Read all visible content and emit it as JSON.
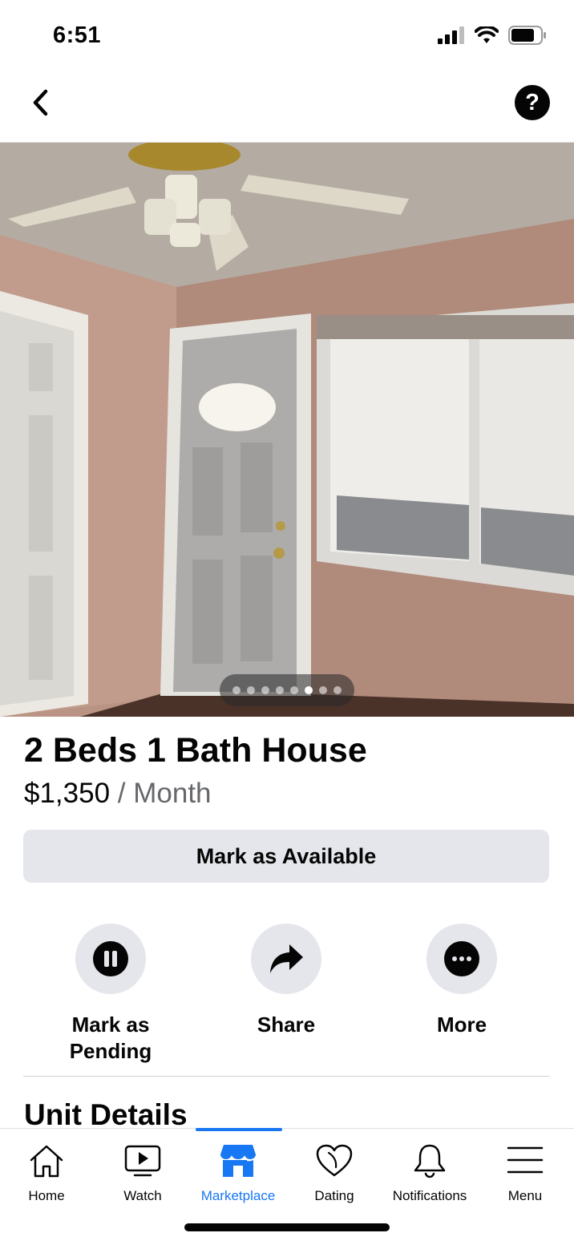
{
  "status_bar": {
    "time": "6:51",
    "icons": [
      "cellular-signal-icon",
      "wifi-icon",
      "battery-icon"
    ]
  },
  "nav": {
    "back_icon": "chevron-left-icon",
    "help_icon": "question-mark-icon",
    "help_glyph": "?"
  },
  "photo": {
    "page_count": 8,
    "active_index": 5
  },
  "listing": {
    "title": "2 Beds 1 Bath House",
    "price": "$1,350",
    "period": " / Month",
    "primary_button": "Mark as Available"
  },
  "actions": [
    {
      "label": "Mark as\nPending",
      "icon": "pause-icon"
    },
    {
      "label": "Share",
      "icon": "share-arrow-icon"
    },
    {
      "label": "More",
      "icon": "more-dots-icon"
    }
  ],
  "section": {
    "title": "Unit Details"
  },
  "tabs": [
    {
      "label": "Home",
      "icon": "home-icon",
      "active": false
    },
    {
      "label": "Watch",
      "icon": "watch-icon",
      "active": false
    },
    {
      "label": "Marketplace",
      "icon": "marketplace-icon",
      "active": true
    },
    {
      "label": "Dating",
      "icon": "dating-heart-icon",
      "active": false
    },
    {
      "label": "Notifications",
      "icon": "bell-icon",
      "active": false
    },
    {
      "label": "Menu",
      "icon": "hamburger-menu-icon",
      "active": false
    }
  ],
  "colors": {
    "accent": "#1877f2",
    "button_bg": "#e4e6eb",
    "text": "#050505",
    "secondary_text": "#65676b"
  }
}
